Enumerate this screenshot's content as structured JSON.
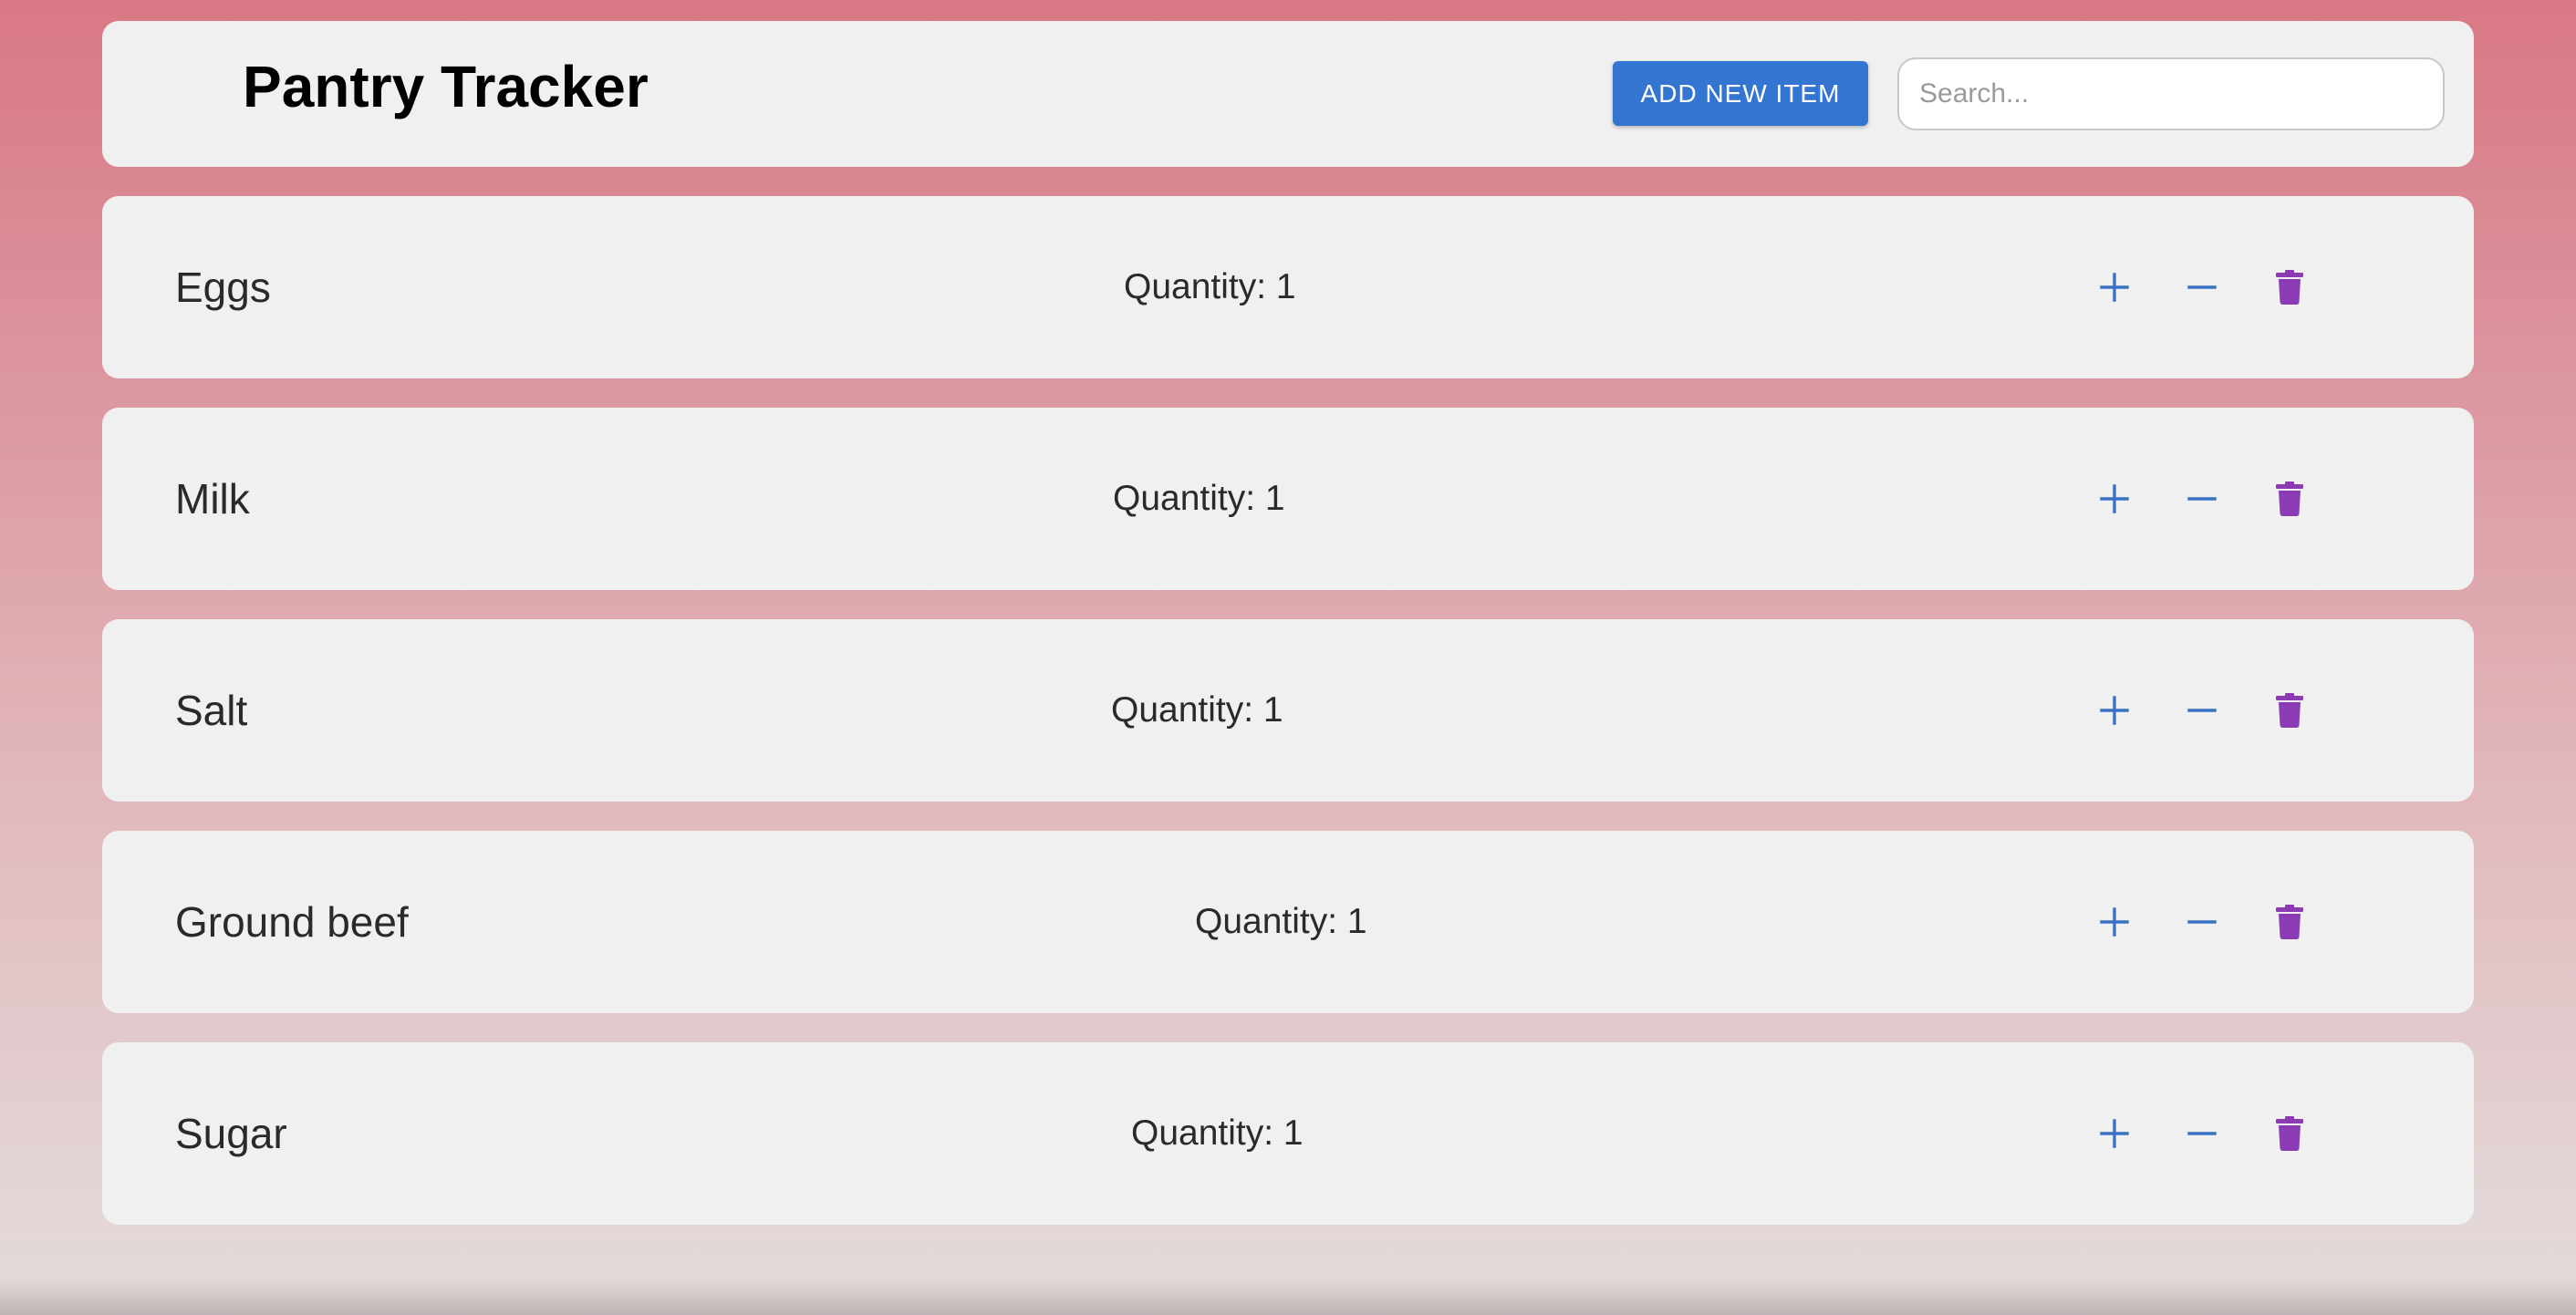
{
  "app": {
    "title": "Pantry Tracker"
  },
  "toolbar": {
    "add_label": "ADD NEW ITEM",
    "search_placeholder": "Search...",
    "search_value": ""
  },
  "colors": {
    "primary": "#3375d1",
    "increment": "#3a73c4",
    "delete": "#8b3bb3",
    "card": "#f0f0f0"
  },
  "icons": {
    "increment": "plus-icon",
    "decrement": "minus-icon",
    "delete": "trash-icon"
  },
  "items": [
    {
      "name": "Eggs",
      "quantity_label": "Quantity: 1",
      "quantity": 1
    },
    {
      "name": "Milk",
      "quantity_label": "Quantity: 1",
      "quantity": 1
    },
    {
      "name": "Salt",
      "quantity_label": "Quantity: 1",
      "quantity": 1
    },
    {
      "name": "Ground beef",
      "quantity_label": "Quantity: 1",
      "quantity": 1
    },
    {
      "name": "Sugar",
      "quantity_label": "Quantity: 1",
      "quantity": 1
    }
  ]
}
